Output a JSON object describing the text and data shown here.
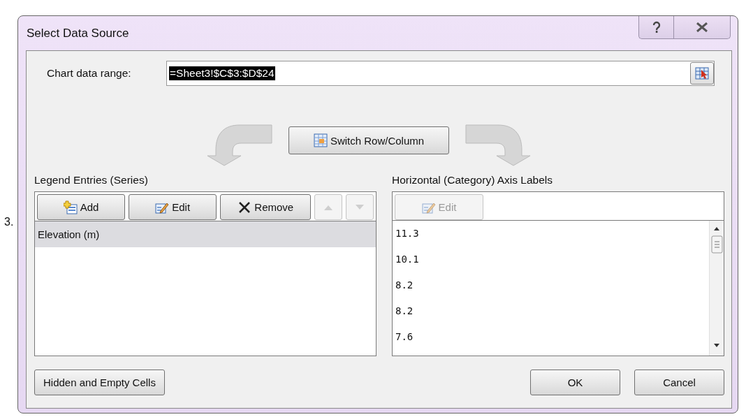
{
  "backdrop_text": "3.",
  "window": {
    "title": "Select Data Source"
  },
  "title_buttons": [
    {
      "kind": "help"
    },
    {
      "kind": "close"
    }
  ],
  "data_range": {
    "label": "Chart data range:",
    "value": "=Sheet3!$C$3:$D$24",
    "selected": true
  },
  "switch_button": "Switch Row/Column",
  "legend_entries": {
    "title": "Legend Entries (Series)",
    "buttons": [
      {
        "kind": "add",
        "label": "Add",
        "disabled": false
      },
      {
        "kind": "edit",
        "label": "Edit",
        "disabled": false
      },
      {
        "kind": "remove",
        "label": "Remove",
        "disabled": false
      },
      {
        "kind": "up",
        "disabled": true
      },
      {
        "kind": "down",
        "disabled": true
      }
    ],
    "items": [
      {
        "label": "Elevation (m)",
        "selected": true
      }
    ]
  },
  "axis_labels": {
    "title": "Horizontal (Category) Axis Labels",
    "buttons": [
      {
        "kind": "edit",
        "label": "Edit",
        "disabled": true
      }
    ],
    "items": [
      {
        "label": "11.3",
        "selected": false
      },
      {
        "label": "10.1",
        "selected": false
      },
      {
        "label": "8.2",
        "selected": false
      },
      {
        "label": "8.2",
        "selected": false
      },
      {
        "label": "7.6",
        "selected": false
      }
    ]
  },
  "footer_buttons": [
    {
      "kind": "left",
      "label": "Hidden and Empty Cells"
    },
    {
      "kind": "right",
      "label": "OK"
    },
    {
      "kind": "right",
      "label": "Cancel"
    }
  ]
}
